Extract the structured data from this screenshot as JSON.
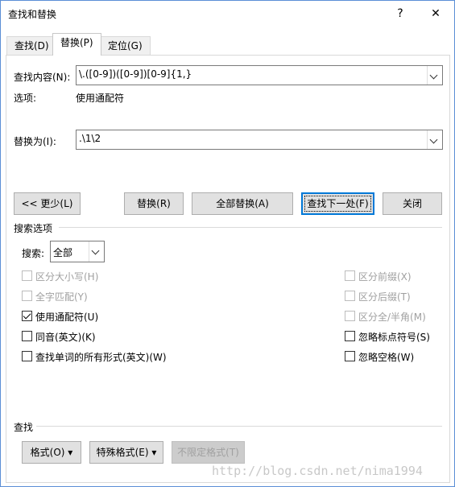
{
  "window": {
    "title": "查找和替换",
    "help_label": "?",
    "close_label": "✕"
  },
  "tabs": [
    {
      "label": "查找(D)"
    },
    {
      "label": "替换(P)"
    },
    {
      "label": "定位(G)"
    }
  ],
  "find": {
    "label": "查找内容(N):",
    "value": "\\.([0-9])([0-9])[0-9]{1,}"
  },
  "options": {
    "label": "选项:",
    "value": "使用通配符"
  },
  "replace": {
    "label": "替换为(I):",
    "value": ".\\1\\2"
  },
  "buttons": {
    "less": "<< 更少(L)",
    "replace": "替换(R)",
    "replace_all": "全部替换(A)",
    "find_next": "查找下一处(F)",
    "close": "关闭"
  },
  "search_options": {
    "header": "搜索选项",
    "search_label": "搜索:",
    "search_value": "全部",
    "checkboxes_left": [
      {
        "label": "区分大小写(H)",
        "checked": false,
        "disabled": true
      },
      {
        "label": "全字匹配(Y)",
        "checked": false,
        "disabled": true
      },
      {
        "label": "使用通配符(U)",
        "checked": true,
        "disabled": false
      },
      {
        "label": "同音(英文)(K)",
        "checked": false,
        "disabled": false
      },
      {
        "label": "查找单词的所有形式(英文)(W)",
        "checked": false,
        "disabled": false
      }
    ],
    "checkboxes_right": [
      {
        "label": "区分前缀(X)",
        "checked": false,
        "disabled": true
      },
      {
        "label": "区分后缀(T)",
        "checked": false,
        "disabled": true
      },
      {
        "label": "区分全/半角(M)",
        "checked": false,
        "disabled": true
      },
      {
        "label": "忽略标点符号(S)",
        "checked": false,
        "disabled": false
      },
      {
        "label": "忽略空格(W)",
        "checked": false,
        "disabled": false
      }
    ]
  },
  "bottom": {
    "header": "查找",
    "format_label": "格式(O) ▾",
    "special_label": "特殊格式(E) ▾",
    "no_format_label": "不限定格式(T)"
  },
  "watermark": "http://blog.csdn.net/nima1994"
}
